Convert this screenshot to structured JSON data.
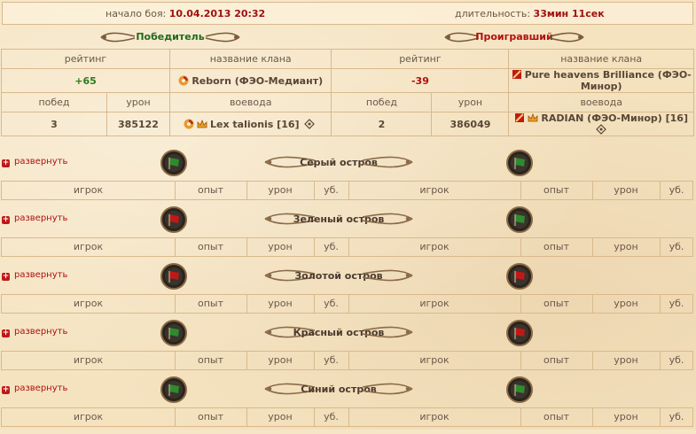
{
  "header": {
    "start_label": "начало боя:",
    "start_value": "10.04.2013 20:32",
    "duration_label": "длительность:",
    "duration_value": "33мин 11сек"
  },
  "winner_label": "Победитель",
  "loser_label": "Проигравший",
  "cols": {
    "rating": "рейтинг",
    "clan": "название клана",
    "wins": "побед",
    "damage": "урон",
    "commander": "воевода"
  },
  "winner": {
    "rating": "+65",
    "clan": "Reborn (ФЭО-Медиант)",
    "wins": "3",
    "damage": "385122",
    "commander": "Lex talionis [16]"
  },
  "loser": {
    "rating": "-39",
    "clan": "Pure heavens Brilliance (ФЭО-Минор)",
    "wins": "2",
    "damage": "386049",
    "commander": "RADIAN (ФЭО-Минор) [16]"
  },
  "expand_label": "развернуть",
  "island_cols": {
    "player": "игрок",
    "exp": "опыт",
    "damage": "урон",
    "kills": "уб."
  },
  "islands": [
    {
      "name": "Серый остров"
    },
    {
      "name": "Зеленый остров"
    },
    {
      "name": "Золотой остров"
    },
    {
      "name": "Красный остров"
    },
    {
      "name": "Синий остров"
    }
  ],
  "colors": {
    "green_flag": "#2e8b2e",
    "red_flag": "#c01818",
    "accent_red": "#a01010"
  }
}
